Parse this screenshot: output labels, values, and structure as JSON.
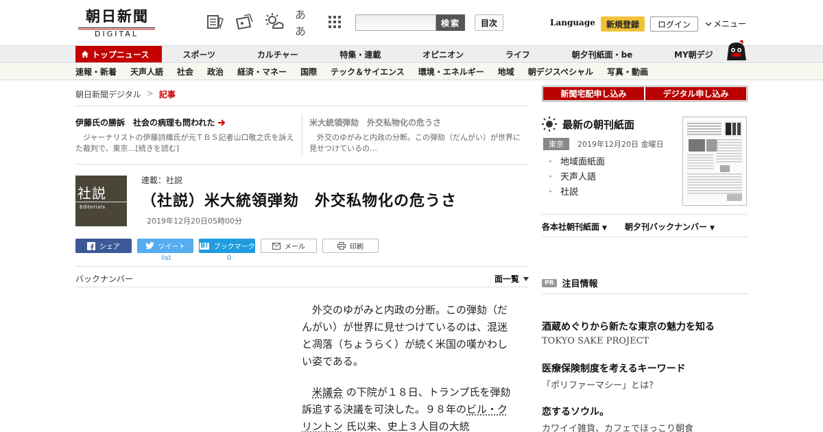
{
  "header": {
    "logo_main": "朝日新聞",
    "logo_sub": "DIGITAL",
    "search_button": "検索",
    "toc_button": "目次",
    "language": "Language",
    "signup": "新規登録",
    "login": "ログイン",
    "menu": "メニュー",
    "font_size_icon": "ああ"
  },
  "nav_primary": [
    {
      "label": "トップニュース",
      "active": true
    },
    {
      "label": "スポーツ"
    },
    {
      "label": "カルチャー"
    },
    {
      "label": "特集・連載"
    },
    {
      "label": "オピニオン"
    },
    {
      "label": "ライフ"
    },
    {
      "label": "朝夕刊紙面・be"
    },
    {
      "label": "MY朝デジ"
    }
  ],
  "nav_secondary": [
    {
      "label": "速報・新着"
    },
    {
      "label": "天声人語"
    },
    {
      "label": "社会"
    },
    {
      "label": "政治"
    },
    {
      "label": "経済・マネー"
    },
    {
      "label": "国際"
    },
    {
      "label": "テック＆サイエンス"
    },
    {
      "label": "環境・エネルギー"
    },
    {
      "label": "地域"
    },
    {
      "label": "朝デジスペシャル"
    },
    {
      "label": "写真・動画"
    }
  ],
  "breadcrumb": {
    "home": "朝日新聞デジタル",
    "sep": ">",
    "current": "記事"
  },
  "related": [
    {
      "title": "伊藤氏の勝訴　社会の病理も問われた",
      "text": "ジャーナリストの伊藤詩織氏が元ＴＢＳ記者山口敬之氏を訴えた裁判で、東京…[続きを読む]"
    },
    {
      "title": "米大統領弾劾　外交私物化の危うさ",
      "text": "外交のゆがみと内政の分断。この弾劾（だんがい）が世界に見せつけているの…"
    }
  ],
  "article": {
    "thumb_big": "社説",
    "thumb_small": "Editorials",
    "series": "連載：社説",
    "headline": "（社説）米大統領弾劾　外交私物化の危うさ",
    "date": "2019年12月20日05時00分",
    "p1": "外交のゆがみと内政の分断。この弾劾（だんがい）が世界に見せつけているのは、混迷と凋落（ちょうらく）が続く米国の嘆かわしい姿である。",
    "p2_link1": "米議会",
    "p2_a": "の下院が１８日、トランプ氏を弾劾訴追する決議を可決した。９８年の",
    "p2_link2": "ビル・クリントン",
    "p2_b": "氏以来、史上３人目の大統"
  },
  "share": {
    "facebook": "シェア",
    "twitter": "ツイート",
    "twitter_count": "list",
    "hatena": "ブックマーク",
    "hatena_count": "0",
    "mail": "メール",
    "print": "印刷"
  },
  "article_nav": {
    "back_numbers": "バックナンバー",
    "page_list": "面一覧"
  },
  "sidebar": {
    "subscribe_paper": "新聞宅配申し込み",
    "subscribe_digital": "デジタル申し込み",
    "paper_title": "最新の朝刊紙面",
    "region": "東京",
    "paper_date": "2019年12月20日 金曜日",
    "paper_list": [
      "地域面紙面",
      "天声人語",
      "社説"
    ],
    "link_regional": "各本社朝刊紙面",
    "link_backnumber": "朝夕刊バックナンバー",
    "pr_badge": "PR",
    "pr_title": "注目情報",
    "ads": [
      {
        "title": "酒蔵めぐりから新たな東京の魅力を知る",
        "sub": "TOKYO SAKE PROJECT"
      },
      {
        "title": "医療保険制度を考えるキーワード",
        "sub": "「ポリファーマシー」とは？"
      },
      {
        "title": "恋するソウル。",
        "sub": "カワイイ雑貨、カフェでほっこり朝食"
      }
    ]
  },
  "colors": {
    "brand_red": "#c40000",
    "facebook": "#3b5998",
    "twitter": "#55acee",
    "hatena": "#1f9bde",
    "signup": "#f0c23a"
  }
}
